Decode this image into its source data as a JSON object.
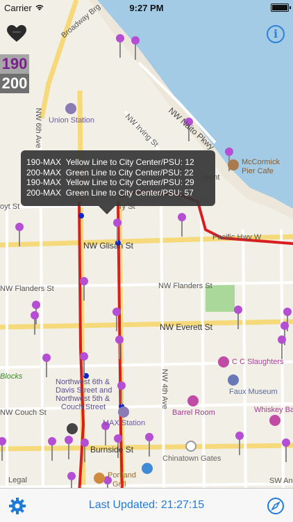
{
  "status": {
    "carrier": "Carrier",
    "time": "9:27 PM"
  },
  "routes": [
    "190",
    "200"
  ],
  "arrivals": [
    {
      "route": "190-MAX",
      "line": "Yellow Line to City Center/PSU",
      "min": "12"
    },
    {
      "route": "200-MAX",
      "line": "Green Line to City Center/PSU",
      "min": "22"
    },
    {
      "route": "190-MAX",
      "line": "Yellow Line to City Center/PSU",
      "min": "29"
    },
    {
      "route": "200-MAX",
      "line": "Green Line to City Center/PSU",
      "min": "57"
    }
  ],
  "map": {
    "streets": [
      "Broadway Brg",
      "NW 6th Ave",
      "NW Naito Pkwy",
      "NW Irving St",
      "NW Hoyt St",
      "NW Glisan St",
      "NW Flanders St",
      "NW Everett St",
      "NW Couch St",
      "NW 4th Ave",
      "Burnside St",
      "Pacific Hwy W",
      "SW Ankeny"
    ],
    "partial_labels": [
      "oyt St",
      "ry St",
      "ment",
      "Blocks",
      "Legal",
      "SW An"
    ],
    "places": [
      "Union Station",
      "McCormick Pier Cafe",
      "C C Slaughters",
      "Faux Museum",
      "Barrel Room",
      "Whiskey Bar",
      "MAX Station",
      "Chinatown Gates",
      "Portland Grill",
      "Northwest 6th & Davis Street and Northwest 5th & Couch Street"
    ]
  },
  "footer": {
    "label": "Last Updated:",
    "time": "21:27:15"
  },
  "colors": {
    "rail": "#d81e1e",
    "accent": "#1f7ad8",
    "pin": "#b44fd3",
    "route190": "#7a1f8c"
  }
}
